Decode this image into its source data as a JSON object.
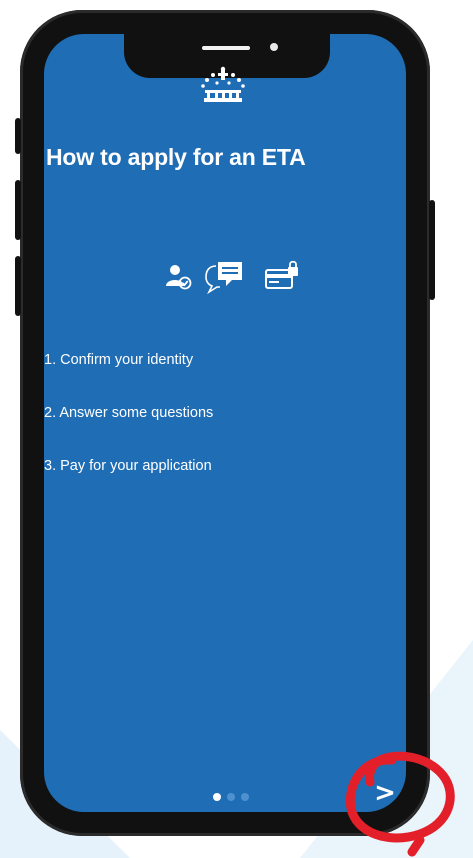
{
  "screen": {
    "title": "How to apply for an ETA",
    "icons": [
      "person-check-icon",
      "chat-bubbles-icon",
      "card-lock-icon"
    ],
    "steps": [
      "1. Confirm your identity",
      "2. Answer some questions",
      "3. Pay for your application"
    ],
    "pagination": {
      "total": 3,
      "active": 1
    },
    "next_label": ">"
  },
  "colors": {
    "screen_background": "#1f6db5",
    "text": "#ffffff",
    "dot_active": "#ffffff",
    "dot_inactive": "#4f91cf",
    "highlight_annotation": "#e3202a",
    "background_triangle": "#eaf4fb"
  }
}
